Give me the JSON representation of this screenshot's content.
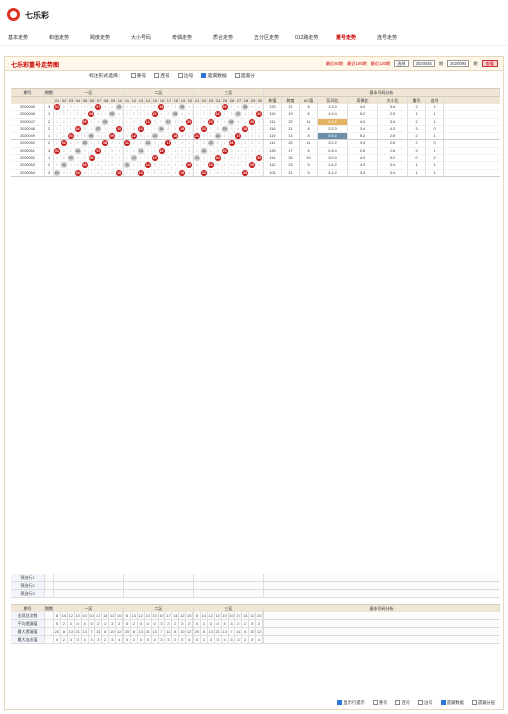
{
  "logo": {
    "text": "七乐彩"
  },
  "nav": [
    "基本走势",
    "和值走势",
    "跨度走势",
    "大小号码",
    "奇偶走势",
    "质合走势",
    "五分区走势",
    "012路走势",
    "重号走势",
    "连号走势"
  ],
  "panel": {
    "title": "七乐彩重号走势图",
    "controls": [
      "最近50期",
      "最近100期",
      "最近120期"
    ],
    "select": "选择",
    "start": "2020045",
    "end": "2020094",
    "button": "查看"
  },
  "options": {
    "label": "标注形式选择：",
    "items": [
      "重号",
      "连号",
      "边号",
      "遗漏数据",
      "遗漏分"
    ]
  },
  "headers": {
    "period": "期号",
    "repeat": "期数",
    "zones": [
      "一区",
      "二区",
      "三区",
      "基本号码分析"
    ],
    "numbers": [
      "01",
      "02",
      "03",
      "04",
      "05",
      "06",
      "07",
      "08",
      "09",
      "10",
      "11",
      "12",
      "13",
      "14",
      "15",
      "16",
      "17",
      "18",
      "19",
      "20",
      "21",
      "22",
      "23",
      "24",
      "25",
      "26",
      "27",
      "28",
      "29",
      "30"
    ],
    "analysis": [
      "和值",
      "跨度",
      "AC值",
      "区间比",
      "奇偶比",
      "大小比",
      "重号",
      "连号"
    ]
  },
  "rows": [
    {
      "id": "2020045",
      "repeat": "3",
      "a": [
        "3",
        "1",
        "2",
        "1",
        "3",
        "3",
        "2",
        "1",
        "3",
        "1"
      ],
      "b": [
        "1",
        "12",
        "1",
        "2",
        "3",
        "1",
        "2",
        "3",
        "4",
        "1"
      ],
      "c": [
        "1",
        "2",
        "1",
        "5",
        "1",
        "3",
        "4",
        "1",
        "2",
        "1"
      ],
      "x": [
        "120",
        "21",
        "8",
        "1:3:3",
        "4:3",
        "3:4",
        "2",
        "1"
      ]
    },
    {
      "id": "2020046",
      "repeat": "1",
      "a": [
        "1",
        "2",
        "1",
        "2",
        "3",
        "1",
        "4",
        "1",
        "2",
        "1"
      ],
      "b": [
        "1",
        "2",
        "1",
        "2",
        "3",
        "1",
        "2",
        "3",
        "4",
        "1"
      ],
      "c": [
        "1",
        "2",
        "1",
        "5",
        "1",
        "3",
        "4",
        "1",
        "2",
        "1"
      ],
      "x": [
        "119",
        "19",
        "8",
        "1:2:4",
        "5:2",
        "2:5",
        "1",
        "1"
      ]
    },
    {
      "id": "2020047",
      "repeat": "2",
      "a": [
        "1",
        "2",
        "1",
        "2",
        "3",
        "1",
        "4",
        "1",
        "2",
        "1"
      ],
      "b": [
        "1",
        "2",
        "1",
        "2",
        "3",
        "1",
        "2",
        "3",
        "4",
        "1"
      ],
      "c": [
        "1",
        "2",
        "1",
        "5",
        "1",
        "3",
        "4",
        "1",
        "2",
        "1"
      ],
      "x": [
        "111",
        "22",
        "11",
        "3:2:2",
        "4:3",
        "3:4",
        "2",
        "1"
      ]
    },
    {
      "id": "2020048",
      "repeat": "2",
      "a": [
        "1",
        "2",
        "1",
        "2",
        "3",
        "1",
        "4",
        "1",
        "2",
        "1"
      ],
      "b": [
        "1",
        "2",
        "1",
        "2",
        "3",
        "1",
        "2",
        "3",
        "4",
        "1"
      ],
      "c": [
        "1",
        "2",
        "1",
        "5",
        "1",
        "3",
        "4",
        "1",
        "2",
        "1"
      ],
      "x": [
        "118",
        "21",
        "8",
        "2:2:3",
        "3:4",
        "4:3",
        "3",
        "0"
      ]
    },
    {
      "id": "2020049",
      "repeat": "1",
      "a": [
        "1",
        "2",
        "1",
        "2",
        "3",
        "1",
        "4",
        "1",
        "2",
        "1"
      ],
      "b": [
        "1",
        "2",
        "1",
        "2",
        "3",
        "1",
        "2",
        "3",
        "4",
        "1"
      ],
      "c": [
        "1",
        "2",
        "1",
        "5",
        "1",
        "3",
        "4",
        "1",
        "2",
        "1"
      ],
      "x": [
        "119",
        "13",
        "8",
        "0:5:2",
        "5:2",
        "2:5",
        "2",
        "1"
      ]
    },
    {
      "id": "2020050",
      "repeat": "2",
      "a": [
        "1",
        "2",
        "1",
        "2",
        "3",
        "1",
        "4",
        "1",
        "2",
        "1"
      ],
      "b": [
        "1",
        "2",
        "1",
        "2",
        "3",
        "1",
        "2",
        "3",
        "4",
        "1"
      ],
      "c": [
        "1",
        "2",
        "1",
        "5",
        "1",
        "3",
        "4",
        "1",
        "2",
        "1"
      ],
      "x": [
        "111",
        "25",
        "11",
        "3:2:2",
        "3:4",
        "2:5",
        "2",
        "0"
      ]
    },
    {
      "id": "2020051",
      "repeat": "3",
      "a": [
        "1",
        "2",
        "1",
        "2",
        "3",
        "1",
        "4",
        "1",
        "2",
        "1"
      ],
      "b": [
        "1",
        "2",
        "1",
        "2",
        "3",
        "1",
        "2",
        "3",
        "4",
        "1"
      ],
      "c": [
        "1",
        "2",
        "1",
        "5",
        "1",
        "3",
        "4",
        "1",
        "2",
        "1"
      ],
      "x": [
        "130",
        "17",
        "8",
        "0:3:4",
        "2:5",
        "1:6",
        "2",
        "1"
      ]
    },
    {
      "id": "2020052",
      "repeat": "1",
      "a": [
        "1",
        "2",
        "1",
        "2",
        "3",
        "1",
        "4",
        "1",
        "2",
        "1"
      ],
      "b": [
        "1",
        "2",
        "1",
        "2",
        "3",
        "1",
        "2",
        "3",
        "4",
        "1"
      ],
      "c": [
        "1",
        "2",
        "1",
        "5",
        "1",
        "3",
        "4",
        "1",
        "2",
        "1"
      ],
      "x": [
        "114",
        "26",
        "10",
        "3:0:4",
        "4:3",
        "5:2",
        "0",
        "2"
      ]
    },
    {
      "id": "2020053",
      "repeat": "2",
      "a": [
        "1",
        "2",
        "1",
        "2",
        "3",
        "1",
        "4",
        "1",
        "2",
        "1"
      ],
      "b": [
        "1",
        "2",
        "1",
        "2",
        "3",
        "1",
        "2",
        "3",
        "4",
        "1"
      ],
      "c": [
        "1",
        "2",
        "1",
        "5",
        "1",
        "3",
        "4",
        "1",
        "2",
        "1"
      ],
      "x": [
        "112",
        "23",
        "9",
        "1:4:2",
        "4:3",
        "3:4",
        "1",
        "1"
      ]
    },
    {
      "id": "2020054",
      "repeat": "3",
      "a": [
        "1",
        "2",
        "1",
        "2",
        "3",
        "1",
        "4",
        "1",
        "2",
        "1"
      ],
      "b": [
        "1",
        "2",
        "1",
        "2",
        "3",
        "1",
        "2",
        "3",
        "4",
        "1"
      ],
      "c": [
        "1",
        "2",
        "1",
        "5",
        "1",
        "3",
        "4",
        "1",
        "2",
        "1"
      ],
      "x": [
        "101",
        "21",
        "9",
        "4:1:2",
        "3:4",
        "3:4",
        "1",
        "1"
      ]
    }
  ],
  "footer": {
    "rows": [
      "预选行1",
      "预选行2",
      "预选行3"
    ],
    "stats": [
      "出现总次数",
      "平均遗漏值",
      "最大遗漏值",
      "最大连出值"
    ],
    "statvals": [
      [
        "8",
        "14",
        "12",
        "10",
        "10",
        "10",
        "17",
        "14",
        "12",
        "10"
      ],
      [
        "5",
        "2",
        "3",
        "4",
        "4",
        "3",
        "2",
        "2",
        "3",
        "2"
      ],
      [
        "20",
        "8",
        "13",
        "21",
        "13",
        "7",
        "11",
        "8",
        "10",
        "12"
      ],
      [
        "0",
        "2",
        "3",
        "3",
        "4",
        "3",
        "3",
        "2",
        "3",
        "4"
      ]
    ]
  },
  "bottom": {
    "label": "显示行提示",
    "items": [
      "重号",
      "连号",
      "边号",
      "遗漏数据",
      "遗漏分层"
    ]
  }
}
